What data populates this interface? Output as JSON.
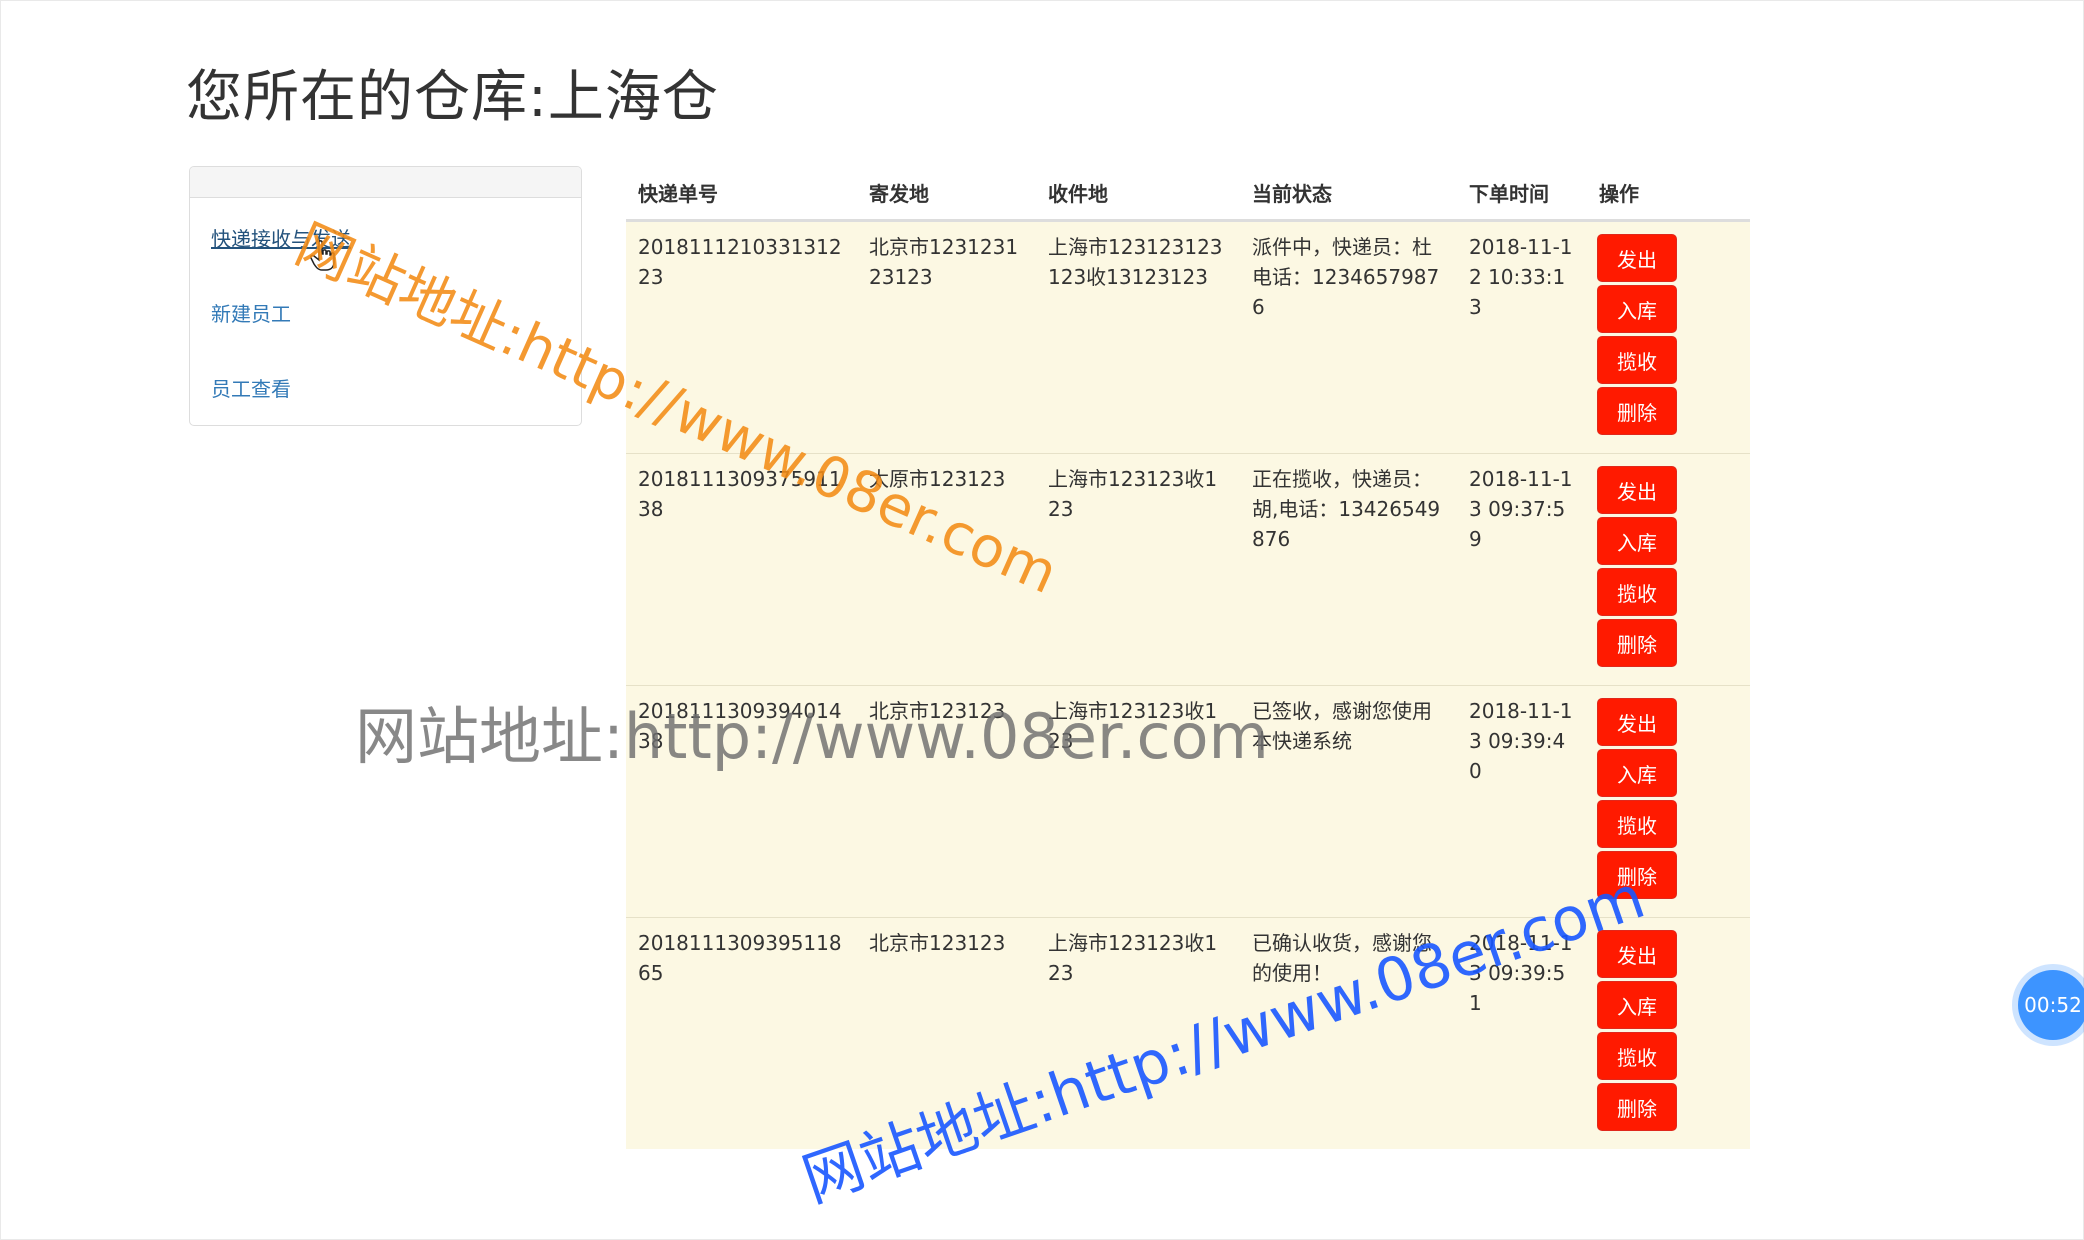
{
  "header": {
    "title": "您所在的仓库:上海仓"
  },
  "sidebar": {
    "items": [
      {
        "label": "快递接收与发送"
      },
      {
        "label": "新建员工"
      },
      {
        "label": "员工查看"
      }
    ]
  },
  "table": {
    "columns": [
      "快递单号",
      "寄发地",
      "收件地",
      "当前状态",
      "下单时间",
      "操作"
    ],
    "rows": [
      {
        "id": "201811121033131223",
        "from": "北京市123123123123",
        "to": "上海市123123123123收13123123",
        "status": "派件中，快递员：杜电话：12346579876",
        "time": "2018-11-12 10:33:13"
      },
      {
        "id": "201811130937591138",
        "from": "太原市123123",
        "to": "上海市123123收123",
        "status": "正在揽收，快递员：胡,电话：13426549876",
        "time": "2018-11-13 09:37:59"
      },
      {
        "id": "201811130939401438",
        "from": "北京市123123",
        "to": "上海市123123收123",
        "status": "已签收，感谢您使用本快递系统",
        "time": "2018-11-13 09:39:40"
      },
      {
        "id": "201811130939511865",
        "from": "北京市123123",
        "to": "上海市123123收123",
        "status": "已确认收货，感谢您的使用！",
        "time": "2018-11-13 09:39:51"
      }
    ],
    "actions": [
      "发出",
      "入库",
      "揽收",
      "删除"
    ]
  },
  "watermark": {
    "text": "网站地址:http://www.08er.com"
  },
  "timer": {
    "value": "00:52"
  },
  "colors": {
    "action_button": "#ff1a00",
    "row_background": "#fcf8e3",
    "link": "#337ab7",
    "timer_badge": "#3d94ff"
  },
  "icons": {
    "cursor": "hand-pointer-icon"
  }
}
